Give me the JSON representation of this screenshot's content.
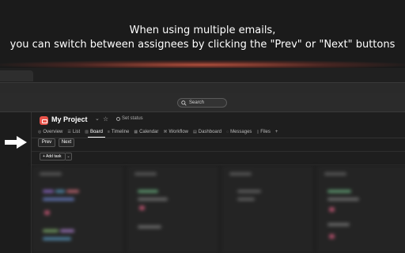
{
  "banner": {
    "line1": "When using multiple emails,",
    "line2": "you can switch between assignees by clicking the \"Prev\" or \"Next\" buttons"
  },
  "topbar": {
    "search_label": "Search"
  },
  "project": {
    "name": "My Project",
    "status_label": "Set status",
    "accent_color": "#e8534a"
  },
  "tabs": [
    {
      "label": "Overview",
      "icon": "overview-icon"
    },
    {
      "label": "List",
      "icon": "list-icon"
    },
    {
      "label": "Board",
      "icon": "board-icon",
      "active": true
    },
    {
      "label": "Timeline",
      "icon": "timeline-icon"
    },
    {
      "label": "Calendar",
      "icon": "calendar-icon"
    },
    {
      "label": "Workflow",
      "icon": "workflow-icon"
    },
    {
      "label": "Dashboard",
      "icon": "dashboard-icon"
    },
    {
      "label": "Messages",
      "icon": "messages-icon"
    },
    {
      "label": "Files",
      "icon": "files-icon"
    }
  ],
  "nav": {
    "prev_label": "Prev",
    "next_label": "Next"
  },
  "toolbar": {
    "add_task_label": "+ Add task"
  }
}
